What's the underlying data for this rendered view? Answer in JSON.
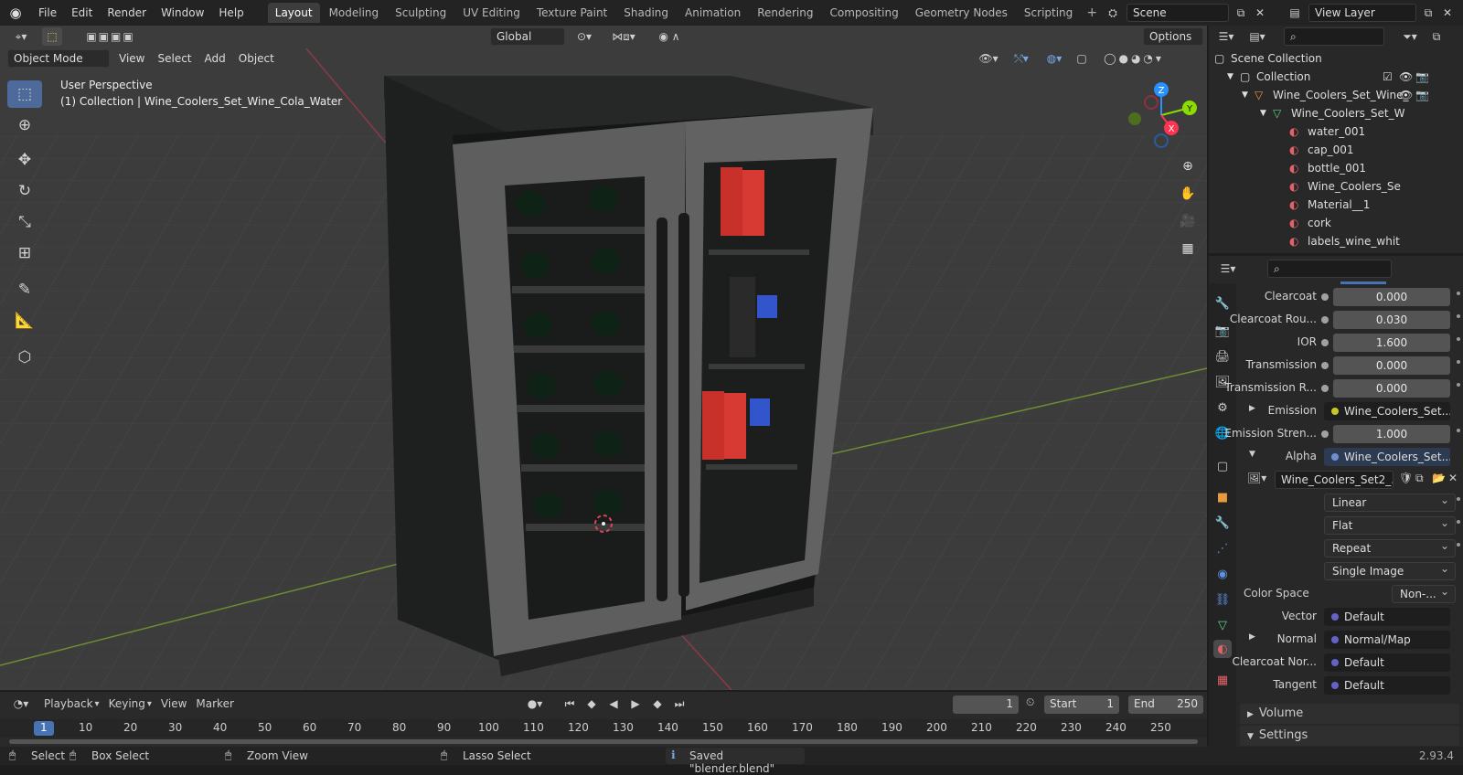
{
  "menu": [
    "File",
    "Edit",
    "Render",
    "Window",
    "Help"
  ],
  "tabs": [
    "Layout",
    "Modeling",
    "Sculpting",
    "UV Editing",
    "Texture Paint",
    "Shading",
    "Animation",
    "Rendering",
    "Compositing",
    "Geometry Nodes",
    "Scripting"
  ],
  "tab_active": "Layout",
  "scene": "Scene",
  "view_layer": "View Layer",
  "vp_header": {
    "mode": "Object Mode",
    "view": "View",
    "select": "Select",
    "add": "Add",
    "object": "Object",
    "orientation": "Global",
    "options": "Options"
  },
  "viewport": {
    "perspective": "User Perspective",
    "collection_info": "(1) Collection | Wine_Coolers_Set_Wine_Cola_Water"
  },
  "gizmo": {
    "z": "Z",
    "y": "Y",
    "x": "X"
  },
  "outliner": {
    "scene_collection": "Scene Collection",
    "collection": "Collection",
    "object": "Wine_Coolers_Set_Wine_",
    "mesh": "Wine_Coolers_Set_W",
    "materials": [
      "water_001",
      "cap_001",
      "bottle_001",
      "Wine_Coolers_Se",
      "Material__1",
      "cork",
      "labels_wine_whit"
    ]
  },
  "props": {
    "rows": [
      {
        "label": "Clearcoat",
        "value": "0.000"
      },
      {
        "label": "Clearcoat Rou...",
        "value": "0.030"
      },
      {
        "label": "IOR",
        "value": "1.600"
      },
      {
        "label": "Transmission",
        "value": "0.000"
      },
      {
        "label": "Transmission R...",
        "value": "0.000"
      }
    ],
    "emission": {
      "label": "Emission",
      "value": "Wine_Coolers_Set..."
    },
    "emission_strength": {
      "label": "Emission Stren...",
      "value": "1.000"
    },
    "alpha": {
      "label": "Alpha",
      "value": "Wine_Coolers_Set..."
    },
    "image_name": "Wine_Coolers_Set2_...",
    "dropdowns": [
      "Linear",
      "Flat",
      "Repeat",
      "Single Image"
    ],
    "color_space": {
      "label": "Color Space",
      "value": "Non-..."
    },
    "links": [
      {
        "label": "Vector",
        "value": "Default"
      },
      {
        "label": "Normal",
        "value": "Normal/Map"
      },
      {
        "label": "Clearcoat Nor...",
        "value": "Default"
      },
      {
        "label": "Tangent",
        "value": "Default"
      }
    ],
    "panels": [
      "Volume",
      "Settings"
    ]
  },
  "timeline": {
    "playback": "Playback",
    "keying": "Keying",
    "view": "View",
    "marker": "Marker",
    "current_frame": "1",
    "start_label": "Start",
    "start": "1",
    "end_label": "End",
    "end": "250",
    "ruler": [
      "1",
      "10",
      "20",
      "30",
      "40",
      "50",
      "60",
      "70",
      "80",
      "90",
      "100",
      "110",
      "120",
      "130",
      "140",
      "150",
      "160",
      "170",
      "180",
      "190",
      "200",
      "210",
      "220",
      "230",
      "240",
      "250"
    ]
  },
  "status": {
    "select": "Select",
    "box_select": "Box Select",
    "zoom_view": "Zoom View",
    "lasso_select": "Lasso Select",
    "message": "Saved \"blender.blend\"",
    "version": "2.93.4"
  },
  "colors": {
    "accent": "#4772b3",
    "viewport_bg": "#3c3c3c",
    "panel_bg": "#282828",
    "x_axis": "#ff3352",
    "y_axis": "#8bdc00",
    "z_axis": "#2890ff",
    "emission_socket": "#c7c729",
    "color_socket": "#c7c729",
    "vector_socket": "#6363c7"
  }
}
